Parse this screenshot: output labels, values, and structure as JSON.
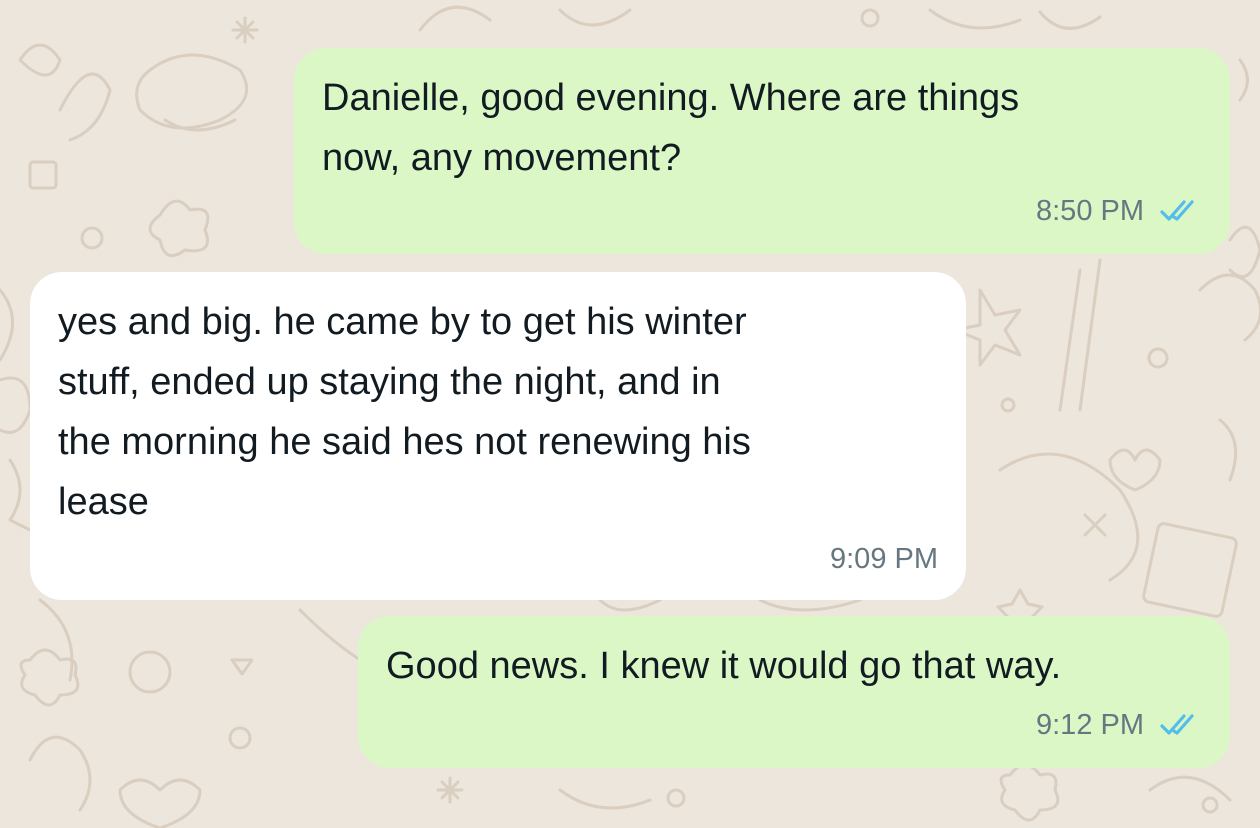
{
  "chat": {
    "messages": [
      {
        "direction": "outgoing",
        "text": "Danielle, good evening. Where are things\nnow, any movement?",
        "time": "8:50 PM",
        "status": "read",
        "status_icon": "double-check-icon"
      },
      {
        "direction": "incoming",
        "text": "yes and big. he came by to get his winter\nstuff, ended up staying the night, and in\nthe morning he said hes not renewing his\nlease",
        "time": "9:09 PM"
      },
      {
        "direction": "outgoing",
        "text": "Good news. I knew it would go that way.",
        "time": "9:12 PM",
        "status": "read",
        "status_icon": "double-check-icon"
      }
    ]
  },
  "colors": {
    "background": "#ede6dd",
    "outgoing_bubble": "#dbf7c6",
    "incoming_bubble": "#ffffff",
    "text": "#111b21",
    "timestamp": "#667781",
    "read_ticks": "#53bdeb"
  }
}
